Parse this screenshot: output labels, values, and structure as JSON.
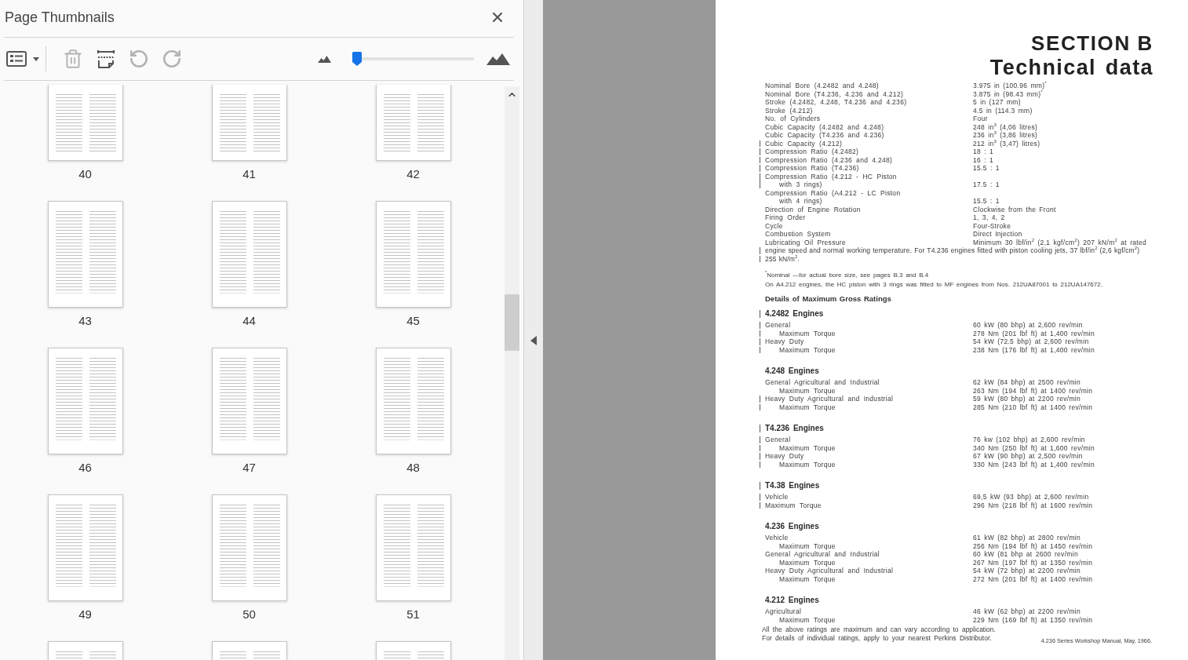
{
  "panel": {
    "title": "Page Thumbnails"
  },
  "toolbar": {
    "tools": [
      {
        "kind": "options",
        "disabled": false
      },
      {
        "kind": "delete",
        "disabled": true
      },
      {
        "kind": "extract",
        "disabled": false
      },
      {
        "kind": "rotate_ccw",
        "disabled": true
      },
      {
        "kind": "rotate_cw",
        "disabled": true
      }
    ],
    "zoom_slider": {
      "level": 0.04
    }
  },
  "thumbnail_rows": [
    {
      "kind": "cut_top",
      "pages": [
        {
          "label": "40",
          "selected": false
        },
        {
          "label": "41",
          "selected": false
        },
        {
          "label": "42",
          "selected": false
        }
      ]
    },
    {
      "kind": "full",
      "pages": [
        {
          "label": "43",
          "selected": false
        },
        {
          "label": "44",
          "selected": false
        },
        {
          "label": "45",
          "selected": false
        }
      ]
    },
    {
      "kind": "full",
      "pages": [
        {
          "label": "46",
          "selected": false
        },
        {
          "label": "47",
          "selected": false
        },
        {
          "label": "48",
          "selected": false
        }
      ]
    },
    {
      "kind": "full",
      "pages": [
        {
          "label": "49",
          "selected": false
        },
        {
          "label": "50",
          "selected": false
        },
        {
          "label": "51",
          "selected": false
        }
      ]
    },
    {
      "kind": "cut_bottom",
      "pages": [
        {
          "selected": false
        },
        {
          "selected": false
        },
        {
          "selected": false
        }
      ]
    }
  ],
  "document": {
    "section": "SECTION B",
    "title": "Technical data",
    "specs": [
      {
        "kind": "row",
        "label_lines": [
          "Nominal Bore (4.2482 and 4.248)"
        ],
        "value": "3.975 in (100.96 mm)$^{*}$",
        "bar": false
      },
      {
        "kind": "row",
        "label_lines": [
          "Nominal Bore (T4.236, 4.236 and 4.212)"
        ],
        "value": "3.875 in (98.43 mm)$^{*}$",
        "bar": false
      },
      {
        "kind": "row",
        "label_lines": [
          "Stroke (4.2482, 4.248, T4.236 and 4.236)"
        ],
        "value": "5 in (127 mm)",
        "bar": false
      },
      {
        "kind": "row",
        "label_lines": [
          "Stroke (4.212)"
        ],
        "value": "4.5 in (114.3 mm)",
        "bar": false
      },
      {
        "kind": "row",
        "label_lines": [
          "No. of Cylinders"
        ],
        "value": "Four",
        "bar": false
      },
      {
        "kind": "row",
        "label_lines": [
          "Cubic Capacity (4.2482 and 4.248)"
        ],
        "value": "248 in$^{3}$ (4,06 litres)",
        "bar": false
      },
      {
        "kind": "row",
        "label_lines": [
          "Cubic Capacity (T4.236 and 4.236)"
        ],
        "value": "236 in$^{3}$ (3,86 litres)",
        "bar": false
      },
      {
        "kind": "row",
        "label_lines": [
          "Cubic Capacity (4.212)"
        ],
        "value": "212 in$^{3}$ (3,47) litres)",
        "bar": true
      },
      {
        "kind": "row",
        "label_lines": [
          "Compression Ratio (4.2482)"
        ],
        "value": "18 : 1",
        "bar": true
      },
      {
        "kind": "row",
        "label_lines": [
          "Compression Ratio (4.236 and 4.248)"
        ],
        "value": "16 : 1",
        "bar": true
      },
      {
        "kind": "row",
        "label_lines": [
          "Compression Ratio (T4.236)"
        ],
        "value": "15.5 : 1",
        "bar": true
      },
      {
        "kind": "row",
        "label_lines": [
          "Compression Ratio (4.212 - HC Piston",
          "with 3 rings)"
        ],
        "value": "17.5 : 1",
        "bar": true
      },
      {
        "kind": "row",
        "label_lines": [
          "Compression Ratio (A4.212 - LC Piston",
          "with 4 rings)"
        ],
        "value": "15.5 : 1",
        "bar": false
      },
      {
        "kind": "row",
        "label_lines": [
          "Direction of Engine Rotation"
        ],
        "value": "Clockwise from the Front",
        "bar": false
      },
      {
        "kind": "row",
        "label_lines": [
          "Firing Order"
        ],
        "value": "1, 3, 4, 2",
        "bar": false
      },
      {
        "kind": "row",
        "label_lines": [
          "Cycle"
        ],
        "value": "Four-Stroke",
        "bar": false
      },
      {
        "kind": "row",
        "label_lines": [
          "Combustion System"
        ],
        "value": "Direct Injection",
        "bar": false
      },
      {
        "kind": "row",
        "label_lines": [
          "Lubricating Oil Pressure"
        ],
        "value": "Minimum 30 lbf/in$^{2}$ (2,1 kgf/cm$^{2}$) 207 kN/m$^{2}$ at rated",
        "bar": false
      },
      {
        "kind": "line",
        "text": "engine speed and normal working temperature. For T4.236 engines fitted with piston cooling jets, 37 lbf/in$^{2}$ (2,6 kgf/cm$^{2}$)",
        "bar": true
      },
      {
        "kind": "line",
        "text": "255 kN/m$^{2}$.",
        "bar": true
      }
    ],
    "notes": [
      "$^{*}$Nominal —for actual bore size, see pages B.3 and B.4",
      "On A4.212 engines, the HC piston with 3 rings was fitted to MF engines from Nos. 212UA87001 to 212UA147672."
    ],
    "ratings_title": "Details of Maximum Gross Ratings",
    "engines": [
      {
        "heading": "4.2482 Engines",
        "bar": true,
        "rows": [
          {
            "label": "General",
            "value": "60 kW (80 bhp) at 2,600 rev/min",
            "bar": true,
            "children": [
              {
                "label": "Maximum Torque",
                "value": "278 Nm (201 lbf ft) at 1,400 rev/min",
                "bar": true
              }
            ]
          },
          {
            "label": "Heavy Duty",
            "value": "54 kW (72.5 bhp) at 2,600 rev/min",
            "bar": true,
            "children": [
              {
                "label": "Maximum Torque",
                "value": "238 Nm (176 lbf ft) at 1,400 rev/min",
                "bar": true
              }
            ]
          }
        ]
      },
      {
        "heading": "4.248 Engines",
        "bar": false,
        "rows": [
          {
            "label": "General Agricultural and Industrial",
            "value": "62 kW (84 bhp) at 2500 rev/min",
            "bar": false,
            "children": [
              {
                "label": "Maximum Torque",
                "value": "263 Nm (194 lbf ft) at 1400 rev/min",
                "bar": false
              }
            ]
          },
          {
            "label": "Heavy Duty Agricultural and Industrial",
            "value": "59 kW (80 bhp) at 2200 rev/min",
            "bar": true,
            "children": [
              {
                "label": "Maximum Torque",
                "value": "285 Nm (210 lbf ft) at 1400 rev/min",
                "bar": true
              }
            ]
          }
        ]
      },
      {
        "heading": "T4.236 Engines",
        "bar": true,
        "rows": [
          {
            "label": "General",
            "value": "76 kw (102 bhp) at 2,600 rev/min",
            "bar": true,
            "children": [
              {
                "label": "Maximum Torque",
                "value": "340 Nm (250 lbf ft) at 1,600 rev/min",
                "bar": true
              }
            ]
          },
          {
            "label": "Heavy Duty",
            "value": "67 kW (90 bhp) at 2,500 rev/min",
            "bar": true,
            "children": [
              {
                "label": "Maximum Torque",
                "value": "330 Nm (243 lbf ft) at 1,400 rev/min",
                "bar": true
              }
            ]
          }
        ]
      },
      {
        "heading": "T4.38 Engines",
        "bar": true,
        "rows": [
          {
            "label": "Vehicle",
            "value": "69,5 kW (93 bhp) at 2,600 rev/min",
            "bar": true
          },
          {
            "label": "Maximum Torque",
            "value": "296 Nm (218 lbf ft) at 1600 rev/min",
            "bar": true
          }
        ]
      },
      {
        "heading": "4.236 Engines",
        "bar": false,
        "rows": [
          {
            "label": "Vehicle",
            "value": "61 kW (82 bhp) at 2800 rev/min",
            "bar": false,
            "children": [
              {
                "label": "Maximum Torque",
                "value": "256 Nm (194 lbf ft) at 1450 rev/min",
                "bar": false
              }
            ]
          },
          {
            "label": "General Agricultural and Industrial",
            "value": "60 kW (81 bhp at 2600 rev/min",
            "bar": false,
            "children": [
              {
                "label": "Maximum Torque",
                "value": "267 Nm (197 lbf ft) at 1350 rev/min",
                "bar": false
              }
            ]
          },
          {
            "label": "Heavy Duty Agricultural and Industrial",
            "value": "54 kW (72 bhp) at 2200 rev/min",
            "bar": false,
            "children": [
              {
                "label": "Maximum Torque",
                "value": "272 Nm (201 lbf ft) at 1400 rev/min",
                "bar": false
              }
            ]
          }
        ]
      },
      {
        "heading": "4.212 Engines",
        "bar": false,
        "rows": [
          {
            "label": "Agricultural",
            "value": "46 kW (62 bhp) at 2200 rev/min",
            "bar": false,
            "children": [
              {
                "label": "Maximum Torque",
                "value": "229 Nm (169 lbf ft) at 1350 rev/min",
                "bar": false
              }
            ]
          }
        ]
      }
    ],
    "closing": [
      "All the above ratings are maximum and can vary according to application.",
      "For details of individual ratings, apply to your nearest Perkins Distributor."
    ],
    "footer": "4.236 Series Workshop Manual, May, 1966."
  }
}
